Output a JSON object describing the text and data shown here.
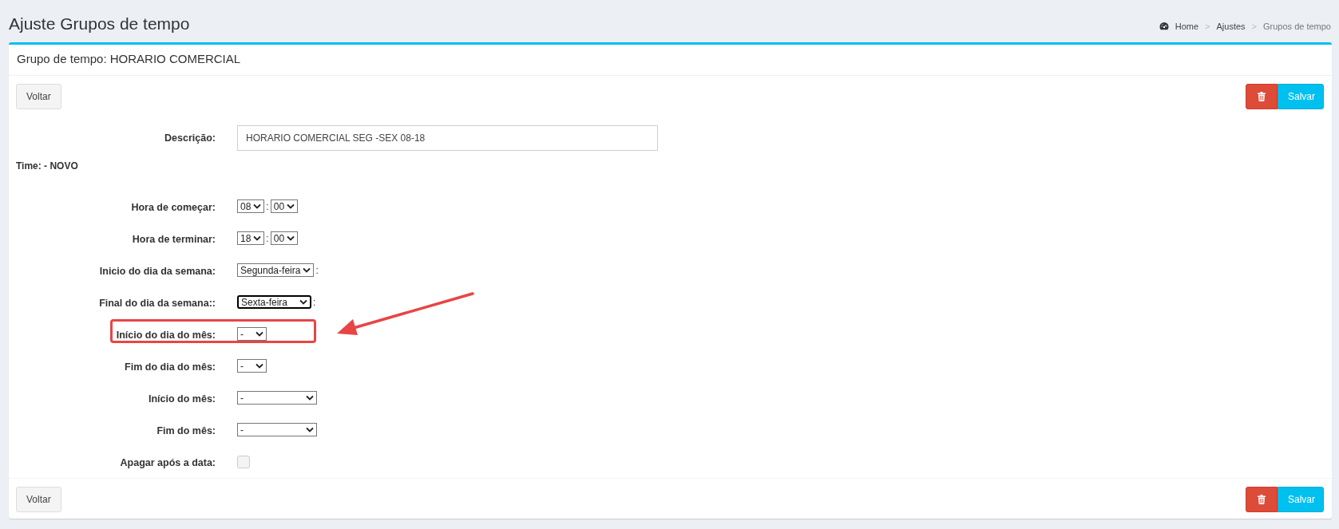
{
  "page_title": "Ajuste Grupos de tempo",
  "breadcrumb": {
    "separator": ">",
    "items": [
      {
        "label": "Home",
        "current": false
      },
      {
        "label": "Ajustes",
        "current": false
      },
      {
        "label": "Grupos de tempo",
        "current": true
      }
    ]
  },
  "panel": {
    "title": "Grupo de tempo: HORARIO COMERCIAL",
    "top_actions": {
      "back_button": "Voltar",
      "save_button": "Salvar"
    },
    "bottom_actions": {
      "back_button": "Voltar",
      "save_button": "Salvar"
    },
    "description": {
      "label": "Descrição:",
      "value": "HORARIO COMERCIAL SEG -SEX 08-18"
    },
    "section_title": "Time: - NOVO",
    "fields": [
      {
        "label": "Hora de começar:",
        "kind": "time",
        "highlighted": false,
        "parts": [
          {
            "kind": "select",
            "value": "08",
            "focused": false
          },
          {
            "kind": "text",
            "text": ":"
          },
          {
            "kind": "select",
            "value": "00",
            "focused": false
          }
        ]
      },
      {
        "label": "Hora de terminar:",
        "kind": "time",
        "highlighted": false,
        "parts": [
          {
            "kind": "select",
            "value": "18",
            "focused": false
          },
          {
            "kind": "text",
            "text": ":"
          },
          {
            "kind": "select",
            "value": "00",
            "focused": false
          }
        ]
      },
      {
        "label": "Inicio do dia da semana:",
        "kind": "weekday",
        "highlighted": false,
        "parts": [
          {
            "kind": "select",
            "value": "Segunda-feira",
            "focused": false
          },
          {
            "kind": "text",
            "text": ":"
          }
        ]
      },
      {
        "label": "Final do dia da semana::",
        "kind": "weekday",
        "highlighted": false,
        "parts": [
          {
            "kind": "select",
            "value": "Sexta-feira",
            "focused": true
          },
          {
            "kind": "text",
            "text": ":"
          }
        ]
      },
      {
        "label": "Início do dia do mês:",
        "kind": "day",
        "highlighted": true,
        "parts": [
          {
            "kind": "select",
            "value": "-",
            "focused": false
          }
        ]
      },
      {
        "label": "Fim do dia do mês:",
        "kind": "day",
        "highlighted": false,
        "parts": [
          {
            "kind": "select",
            "value": "-",
            "focused": false
          }
        ]
      },
      {
        "label": "Início do mês:",
        "kind": "month",
        "highlighted": false,
        "parts": [
          {
            "kind": "select",
            "value": "-",
            "focused": false
          }
        ]
      },
      {
        "label": "Fim do mês:",
        "kind": "month",
        "highlighted": false,
        "parts": [
          {
            "kind": "select",
            "value": "-",
            "focused": false
          }
        ]
      },
      {
        "label": "Apagar após a data:",
        "kind": "checkbox",
        "highlighted": false,
        "parts": [
          {
            "kind": "checkbox",
            "checked": false
          }
        ]
      }
    ]
  }
}
